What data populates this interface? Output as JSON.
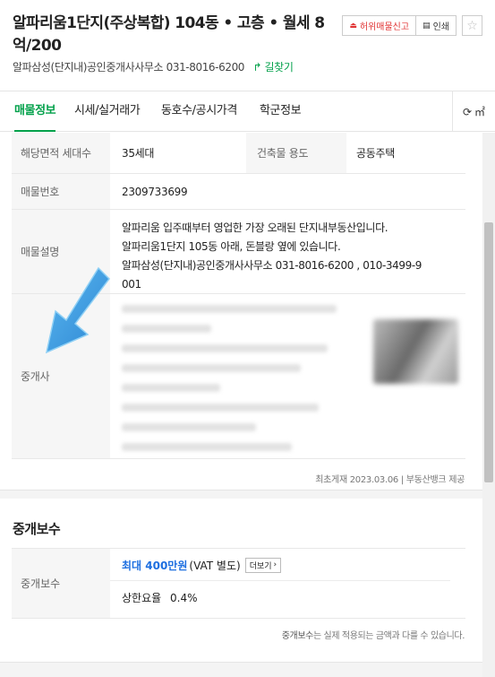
{
  "header": {
    "title": "알파리움1단지(주상복합) 104동 • 고층 • 월세 8억/200",
    "agent_office": "알파삼성(단지내)공인중개사사무소",
    "agent_phone": "031-8016-6200",
    "directions_label": "↱ 길찾기",
    "report_label": "허위매물신고",
    "print_label": "인쇄"
  },
  "tabs": [
    {
      "label": "매물정보",
      "active": true
    },
    {
      "label": "시세/실거래가",
      "active": false
    },
    {
      "label": "동호수/공시가격",
      "active": false
    },
    {
      "label": "학군정보",
      "active": false
    }
  ],
  "unit_toggle": "㎡",
  "info": {
    "households_label": "해당면적 세대수",
    "households_value": "35세대",
    "building_use_label": "건축물 용도",
    "building_use_value": "공동주택",
    "listing_no_label": "매물번호",
    "listing_no_value": "2309733699",
    "description_label": "매물설명",
    "description_lines": [
      "알파리움 입주때부터 영업한 가장 오래된 단지내부동산입니다.",
      "알파리움1단지 105동 아래, 돈블랑 옆에 있습니다.",
      "알파삼성(단지내)공인중개사사무소 031-8016-6200 , 010-3499-9",
      "001"
    ],
    "agent_label": "중개사"
  },
  "first_registered": "최초게재 2023.03.06 | 부동산뱅크 제공",
  "fee": {
    "section_title": "중개보수",
    "label": "중개보수",
    "amount": "최대 400만원",
    "vat": "(VAT 별도)",
    "more_label": "더보기",
    "rate_label": "상한요율",
    "rate_value": "0.4%",
    "note_bold": "중개보수",
    "note_rest": "는 실제 적용되는 금액과 다를 수 있습니다."
  },
  "colors": {
    "accent_green": "#03a14b",
    "fee_blue": "#1e6fe0",
    "report_red": "#e03131",
    "arrow_blue": "#3a9de0"
  }
}
